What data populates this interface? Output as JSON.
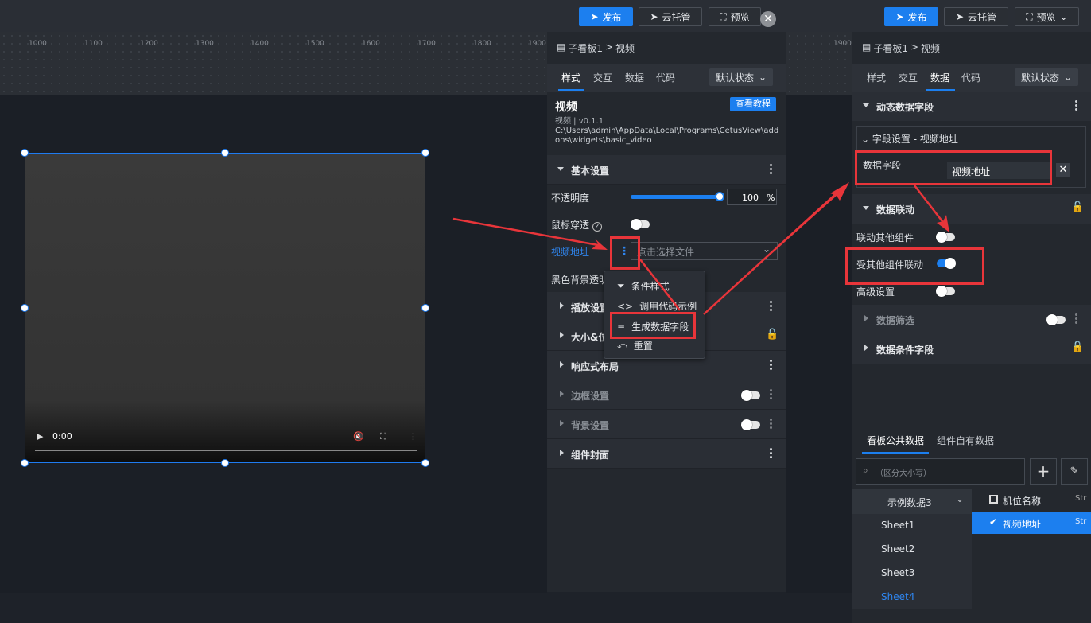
{
  "topbar": {
    "publish": "发布",
    "cloud": "云托管",
    "preview": "预览"
  },
  "ruler": [
    "1000",
    "1100",
    "1200",
    "1300",
    "1400",
    "1500",
    "1600",
    "1700",
    "1800",
    "1900"
  ],
  "ruler_right": "1900",
  "video": {
    "time": "0:00"
  },
  "left_panel": {
    "breadcrumb_parent": "子看板1",
    "breadcrumb_sep": ">",
    "breadcrumb_current": "视频",
    "tabs": [
      "样式",
      "交互",
      "数据",
      "代码"
    ],
    "state_select": "默认状态",
    "widget_title": "视频",
    "widget_version": "视频 | v0.1.1",
    "widget_path": "C:\\Users\\admin\\AppData\\Local\\Programs\\CetusView\\addons\\widgets\\basic_video",
    "tutorial_button": "查看教程",
    "basic_section": "基本设置",
    "opacity_label": "不透明度",
    "opacity_value": "100",
    "opacity_unit": "%",
    "opacity_level": 1.0,
    "mouse_through_label": "鼠标穿透",
    "video_url_label": "视频地址",
    "file_placeholder": "点击选择文件",
    "black_bg_label": "黑色背景透明",
    "sections": [
      "播放设置",
      "大小&位置",
      "响应式布局",
      "边框设置",
      "背景设置",
      "组件封面"
    ]
  },
  "context_menu": {
    "items": [
      "条件样式",
      "调用代码示例",
      "生成数据字段",
      "重置"
    ]
  },
  "right_panel": {
    "breadcrumb_parent": "子看板1",
    "breadcrumb_sep": ">",
    "breadcrumb_current": "视频",
    "tabs": [
      "样式",
      "交互",
      "数据",
      "代码"
    ],
    "state_select": "默认状态",
    "dynamic_section": "动态数据字段",
    "field_setting": "字段设置 - 视频地址",
    "data_field_label": "数据字段",
    "data_field_value": "视频地址",
    "linkage_section": "数据联动",
    "link_other_label": "联动其他组件",
    "linked_by_label": "受其他组件联动",
    "advanced_label": "高级设置",
    "filter_section": "数据筛选",
    "condition_section": "数据条件字段",
    "bottom_tabs": [
      "看板公共数据",
      "组件自有数据"
    ],
    "search_placeholder": "（区分大小写）",
    "dataset": "示例数据3",
    "sheets": [
      "Sheet1",
      "Sheet2",
      "Sheet3",
      "Sheet4"
    ],
    "columns": [
      {
        "name": "机位名称",
        "type": "Str"
      },
      {
        "name": "视频地址",
        "type": "Str"
      }
    ]
  }
}
